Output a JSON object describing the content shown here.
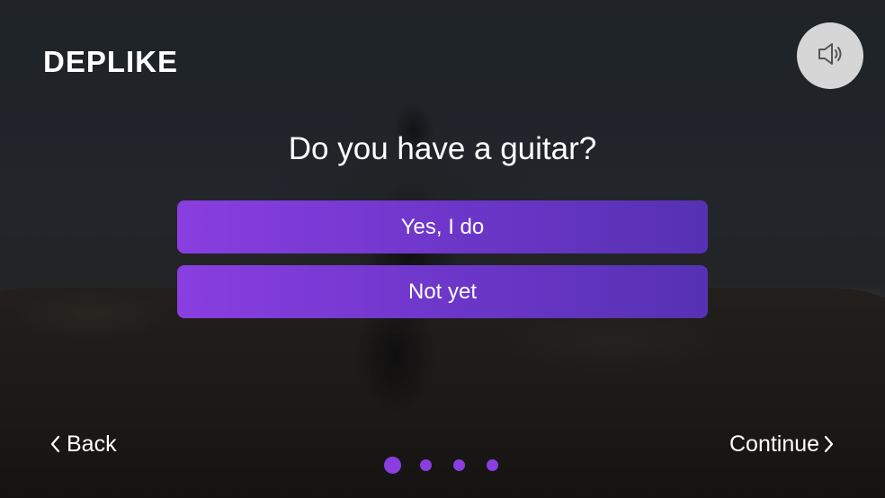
{
  "brand": {
    "logo_text": "DEPLIKE"
  },
  "audio": {
    "icon": "speaker-icon"
  },
  "question": {
    "text": "Do you have a guitar?"
  },
  "options": [
    {
      "label": "Yes, I do"
    },
    {
      "label": "Not yet"
    }
  ],
  "navigation": {
    "back_label": "Back",
    "continue_label": "Continue",
    "back_icon": "chevron-left-icon",
    "continue_icon": "chevron-right-icon"
  },
  "pager": {
    "total_steps": 4,
    "current_step": 1
  },
  "colors": {
    "accent": "#8a3ee0",
    "accent_dark": "#5631b3",
    "text": "#ffffff",
    "sound_button_bg": "#d6d6d6"
  }
}
